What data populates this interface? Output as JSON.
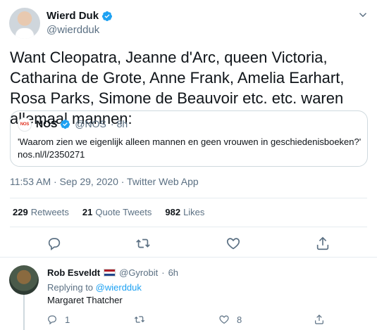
{
  "colors": {
    "accent": "#1da1f2",
    "muted": "#5b7083",
    "text": "#0f1419",
    "nos_red": "#e0301e"
  },
  "tweet": {
    "author_name": "Wierd Duk",
    "author_handle": "@wierdduk",
    "text": "Want Cleopatra, Jeanne d'Arc, queen Victoria, Catharina de Grote, Anne Frank, Amelia Earhart, Rosa Parks, Simone de Beauvoir etc. etc. waren allemaal mannen:",
    "quote": {
      "avatar_text": "NOS",
      "author_name": "NOS",
      "author_handle": "@NOS",
      "separator": "·",
      "time": "8h",
      "text_line1": "'Waarom zien we eigenlijk alleen mannen en geen vrouwen in geschiedenisboeken?'",
      "text_line2": "nos.nl/l/2350271"
    },
    "timestamp": "11:53 AM · Sep 29, 2020 · Twitter Web App",
    "stats": {
      "retweets_count": "229",
      "retweets_label": "Retweets",
      "quote_count": "21",
      "quote_label": "Quote Tweets",
      "likes_count": "982",
      "likes_label": "Likes"
    },
    "actions": [
      "reply-icon",
      "retweet-icon",
      "like-icon",
      "share-icon"
    ]
  },
  "reply": {
    "author_name": "Rob Esveldt",
    "author_handle": "@Gyrobit",
    "separator": "·",
    "time": "6h",
    "replying_prefix": "Replying to",
    "replying_to": "@wierdduk",
    "text": "Margaret Thatcher",
    "reply_count": "1",
    "like_count": "8"
  }
}
